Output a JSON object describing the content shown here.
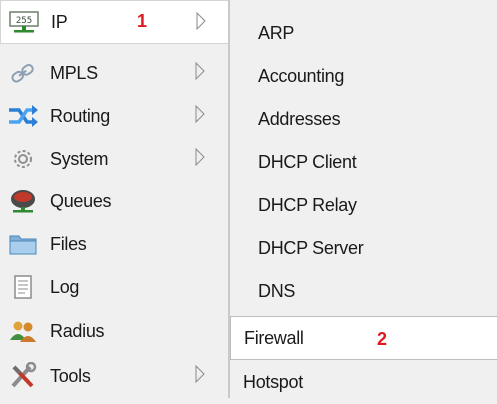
{
  "left_menu": {
    "items": [
      {
        "label": "IP",
        "icon": "ip-address-icon",
        "has_submenu": true
      },
      {
        "label": "MPLS",
        "icon": "mpls-icon",
        "has_submenu": true
      },
      {
        "label": "Routing",
        "icon": "routing-icon",
        "has_submenu": true
      },
      {
        "label": "System",
        "icon": "gear-icon",
        "has_submenu": true
      },
      {
        "label": "Queues",
        "icon": "queues-icon",
        "has_submenu": false
      },
      {
        "label": "Files",
        "icon": "folder-icon",
        "has_submenu": false
      },
      {
        "label": "Log",
        "icon": "log-icon",
        "has_submenu": false
      },
      {
        "label": "Radius",
        "icon": "users-icon",
        "has_submenu": false
      },
      {
        "label": "Tools",
        "icon": "tools-icon",
        "has_submenu": true
      }
    ],
    "active_label": "IP"
  },
  "submenu": {
    "items": [
      {
        "label": "ARP"
      },
      {
        "label": "Accounting"
      },
      {
        "label": "Addresses"
      },
      {
        "label": "DHCP Client"
      },
      {
        "label": "DHCP Relay"
      },
      {
        "label": "DHCP Server"
      },
      {
        "label": "DNS"
      },
      {
        "label": "Firewall"
      },
      {
        "label": "Hotspot"
      }
    ],
    "active_label": "Firewall"
  },
  "annotations": {
    "step1": "1",
    "step2": "2"
  },
  "colors": {
    "annotation": "#e0191f",
    "menu_bg": "#f0f0f0",
    "active_bg": "#ffffff"
  }
}
